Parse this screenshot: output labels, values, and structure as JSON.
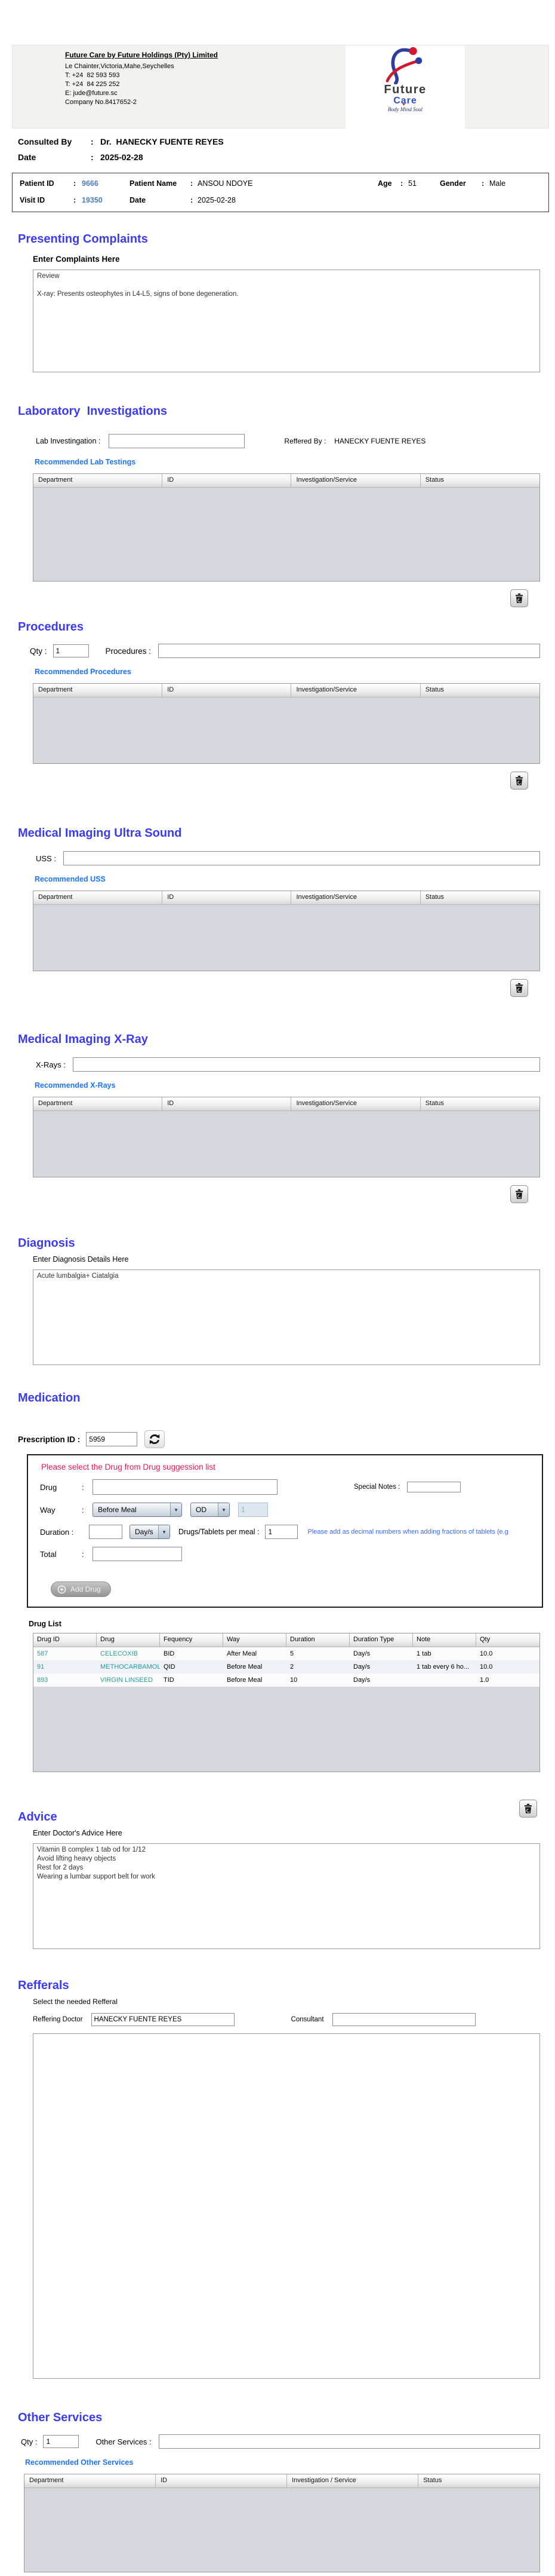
{
  "ui": {
    "colon": ":"
  },
  "colors": {
    "heading_blue": "#3B3BF0",
    "link_blue": "#1D74F2",
    "alert_red": "#E0195C",
    "note_blue": "#3A6BF5",
    "drug_teal": "#2A9B9D",
    "id_blue": "#4B7DC0",
    "table_body_gray": "#D4D8DE"
  },
  "header": {
    "company_name": "Future Care by Future Holdings (Pty) Limited",
    "address": "Le Chainter,Victoria,Mahe,Seychelles",
    "phone1": "T: +24  82 593 593",
    "phone2": "T: +24  84 225 252",
    "email": "E: jude@future.sc",
    "company_no": "Company No.8417652-2",
    "logo": {
      "word1": "Future",
      "word2": "Care",
      "tagline": "Body Mind Soul",
      "heart_icon": "♥"
    }
  },
  "consultation": {
    "consulted_by_label": "Consulted By",
    "consulted_by": "Dr.  HANECKY FUENTE REYES",
    "date_label": "Date",
    "date": "2025-02-28"
  },
  "patient": {
    "patient_id_label": "Patient ID",
    "patient_id": "9666",
    "patient_name_label": "Patient Name",
    "patient_name": "ANSOU NDOYE",
    "age_label": "Age",
    "age": "51",
    "gender_label": "Gender",
    "gender": "Male",
    "visit_id_label": "Visit ID",
    "visit_id": "19350",
    "date_label": "Date",
    "visit_date": "2025-02-28"
  },
  "complaints": {
    "heading": "Presenting Complaints",
    "label": "Enter Complaints Here",
    "text": "Review\n\nX-ray: Presents osteophytes in L4-L5, signs of bone degeneration."
  },
  "lab": {
    "heading": "Laboratory  Investigations",
    "input_label": "Lab Investingation :",
    "input_value": "",
    "referred_label": "Reffered By :",
    "referred_by": "HANECKY FUENTE REYES",
    "link": "Recommended Lab Testings",
    "columns": [
      "Department",
      "ID",
      "Investigation/Service",
      "Status"
    ]
  },
  "procedures": {
    "heading": "Procedures",
    "qty_label": "Qty :",
    "qty": "1",
    "input_label": "Procedures :",
    "input_value": "",
    "link": "Recommended Procedures",
    "columns": [
      "Department",
      "ID",
      "Investigation/Service",
      "Status"
    ]
  },
  "uss": {
    "heading": "Medical Imaging Ultra Sound",
    "input_label": "USS :",
    "input_value": "",
    "link": "Recommended USS",
    "columns": [
      "Department",
      "ID",
      "Investigation/Service",
      "Status"
    ]
  },
  "xray": {
    "heading": "Medical Imaging X-Ray",
    "input_label": "X-Rays :",
    "input_value": "",
    "link": "Recommended X-Rays",
    "columns": [
      "Department",
      "ID",
      "Investigation/Service",
      "Status"
    ]
  },
  "diagnosis": {
    "heading": "Diagnosis",
    "label": "Enter Diagnosis Details Here",
    "text": "Acute lumbalgia+ Ciatalgia"
  },
  "medication": {
    "heading": "Medication",
    "prescription_label": "Prescription ID :",
    "prescription_id": "5959",
    "panel_note": "Please select the Drug from Drug suggession list",
    "drug_label": "Drug",
    "drug_value": "",
    "special_notes_label": "Special Notes :",
    "special_notes_value": "",
    "way_label": "Way",
    "way_value": "Before Meal",
    "frequency_value": "OD",
    "frequency_qty": "1",
    "duration_label": "Duration :",
    "duration_value": "",
    "duration_unit": "Day/s",
    "per_meal_label": "Drugs/Tablets per meal :",
    "per_meal_value": "1",
    "decimal_note": "Please add as decimal numbers when adding fractions of tablets (e.g",
    "total_label": "Total",
    "total_value": "",
    "add_drug_label": "Add Drug",
    "drug_list_label": "Drug List",
    "columns": [
      "Drug ID",
      "Drug",
      "Fequency",
      "Way",
      "Duration",
      "Duration Type",
      "Note",
      "Qty"
    ],
    "rows": [
      {
        "id": "587",
        "drug": "CELECOXIB",
        "freq": "BID",
        "way": "After Meal",
        "duration": "5",
        "duration_type": "Day/s",
        "note": "1 tab",
        "qty": "10.0"
      },
      {
        "id": "91",
        "drug": "METHOCARBAMOL",
        "freq": "QID",
        "way": "Before Meal",
        "duration": "2",
        "duration_type": "Day/s",
        "note": "1 tab every 6 ho...",
        "qty": "10.0"
      },
      {
        "id": "893",
        "drug": "VIRGIN LINSEED",
        "freq": "TID",
        "way": "Before Meal",
        "duration": "10",
        "duration_type": "Day/s",
        "note": "",
        "qty": "1.0"
      }
    ]
  },
  "advice": {
    "heading": "Advice",
    "label": "Enter Doctor's Advice Here",
    "text": "Vitamin B complex 1 tab od for 1/12\nAvoid lifting heavy objects\nRest for 2 days\nWearing a lumbar support belt for work"
  },
  "referrals": {
    "heading": "Refferals",
    "label": "Select the needed Refferal",
    "doctor_label": "Reffering Doctor",
    "doctor_value": "HANECKY FUENTE REYES",
    "consultant_label": "Consultant",
    "consultant_value": ""
  },
  "other_services": {
    "heading": "Other Services",
    "qty_label": "Qty :",
    "qty": "1",
    "input_label": "Other Services :",
    "input_value": "",
    "link": "Recommended Other Services",
    "columns": [
      "Department",
      "ID",
      "Investigation / Service",
      "Status"
    ]
  }
}
